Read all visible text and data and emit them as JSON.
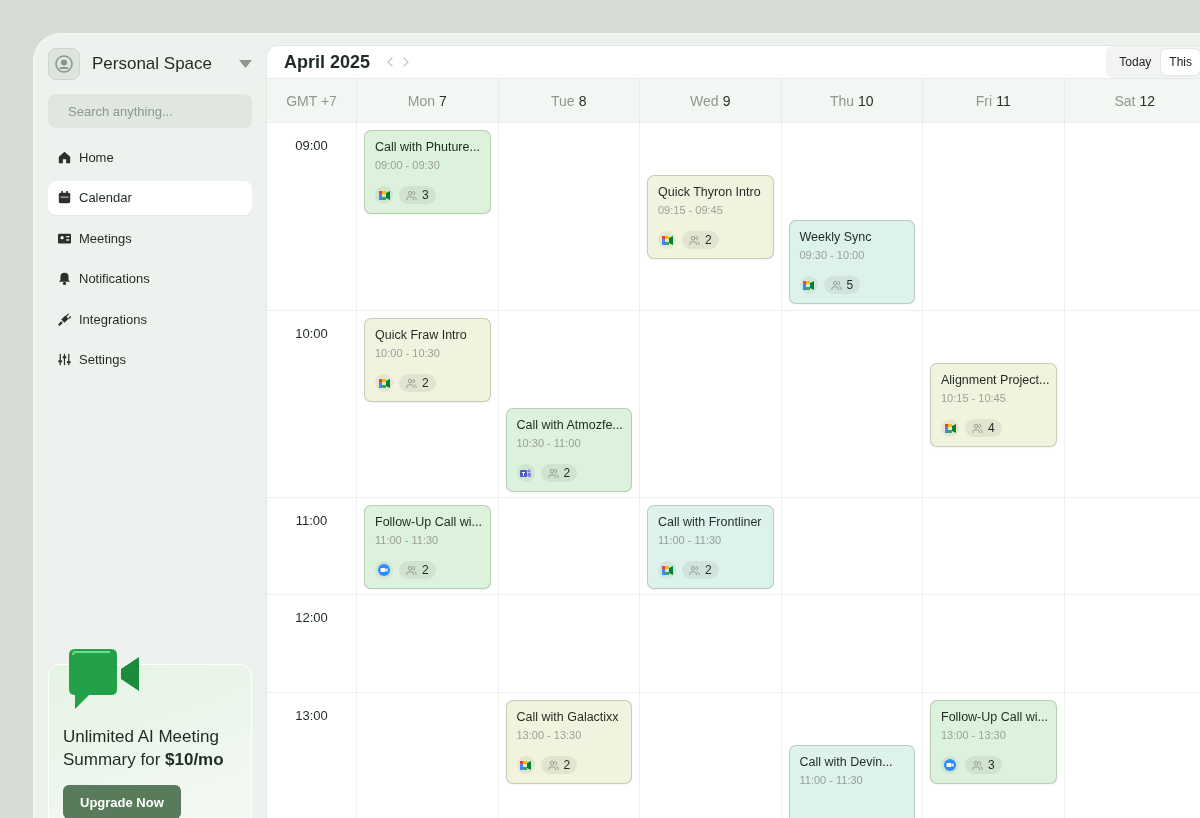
{
  "sidebar": {
    "workspace": "Personal Space",
    "search": {
      "placeholder": "Search anything..."
    },
    "items": [
      {
        "label": "Home",
        "kind": "home",
        "selected": false
      },
      {
        "label": "Calendar",
        "kind": "calendar",
        "selected": true
      },
      {
        "label": "Meetings",
        "kind": "meetings",
        "selected": false
      },
      {
        "label": "Notifications",
        "kind": "bell",
        "selected": false
      },
      {
        "label": "Integrations",
        "kind": "plug",
        "selected": false
      },
      {
        "label": "Settings",
        "kind": "sliders",
        "selected": false
      }
    ],
    "promo": {
      "text": "Unlimited AI Meeting Summary for **$10/mo**",
      "button": "Upgrade Now"
    }
  },
  "calendar": {
    "title": "April 2025",
    "views": [
      {
        "label": "Today",
        "selected": false
      },
      {
        "label": "This",
        "selected": true
      }
    ],
    "timezone": "GMT +7",
    "days": [
      {
        "day": "Mon",
        "date": "7"
      },
      {
        "day": "Tue",
        "date": "8"
      },
      {
        "day": "Wed",
        "date": "9"
      },
      {
        "day": "Thu",
        "date": "10"
      },
      {
        "day": "Fri",
        "date": "11"
      },
      {
        "day": "Sat",
        "date": "12"
      }
    ],
    "rows": [
      {
        "time": "09:00",
        "cells": [
          [
            {
              "title": "Call with Phuture...",
              "time": "09:00 - 09:30",
              "kind": "meet",
              "people": "3",
              "color": "#dcf2dc"
            }
          ],
          [],
          [
            {
              "title": "Quick Thyron Intro",
              "time": "09:15 - 09:45",
              "kind": "meet",
              "people": "2",
              "color": "#f2f3de"
            }
          ],
          [
            {
              "title": "Weekly Sync",
              "time": "09:30 - 10:00",
              "kind": "meet",
              "people": "5",
              "color": "#ddf2ea"
            }
          ],
          [],
          []
        ]
      },
      {
        "time": "10:00",
        "cells": [
          [
            {
              "title": "Quick Fraw Intro",
              "time": "10:00 - 10:30",
              "kind": "meet",
              "people": "2",
              "color": "#f2f3de"
            }
          ],
          [
            {
              "title": "Call with Atmozfe...",
              "time": "10:30 - 11:00",
              "kind": "teams",
              "people": "2",
              "color": "#dcf2dc"
            }
          ],
          [],
          [],
          [
            {
              "title": "Alignment Project...",
              "time": "10:15 - 10:45",
              "kind": "meet",
              "people": "4",
              "color": "#f2f3de"
            }
          ],
          []
        ]
      },
      {
        "time": "11:00",
        "cells": [
          [
            {
              "title": "Follow-Up Call wi...",
              "time": "11:00 - 11:30",
              "kind": "zoom",
              "people": "2",
              "color": "#dcf2dc"
            }
          ],
          [],
          [
            {
              "title": "Call with Frontliner",
              "time": "11:00 - 11:30",
              "kind": "meet",
              "people": "2",
              "color": "#ddf2ea"
            }
          ],
          [],
          [],
          []
        ]
      },
      {
        "time": "12:00",
        "cells": [
          [],
          [],
          [],
          [],
          [],
          []
        ]
      },
      {
        "time": "13:00",
        "cells": [
          [],
          [
            {
              "title": "Call with Galactixx",
              "time": "13:00 - 13:30",
              "kind": "meet",
              "people": "2",
              "color": "#f2f3de"
            }
          ],
          [],
          [
            {
              "title": "Call with Devin...",
              "time": "11:00 - 11:30",
              "color": "#ddf2ea"
            }
          ],
          [
            {
              "title": "Follow-Up Call wi...",
              "time": "13:00 - 13:30",
              "kind": "zoom",
              "people": "3",
              "color": "#dcf2dc"
            }
          ],
          []
        ]
      }
    ]
  }
}
